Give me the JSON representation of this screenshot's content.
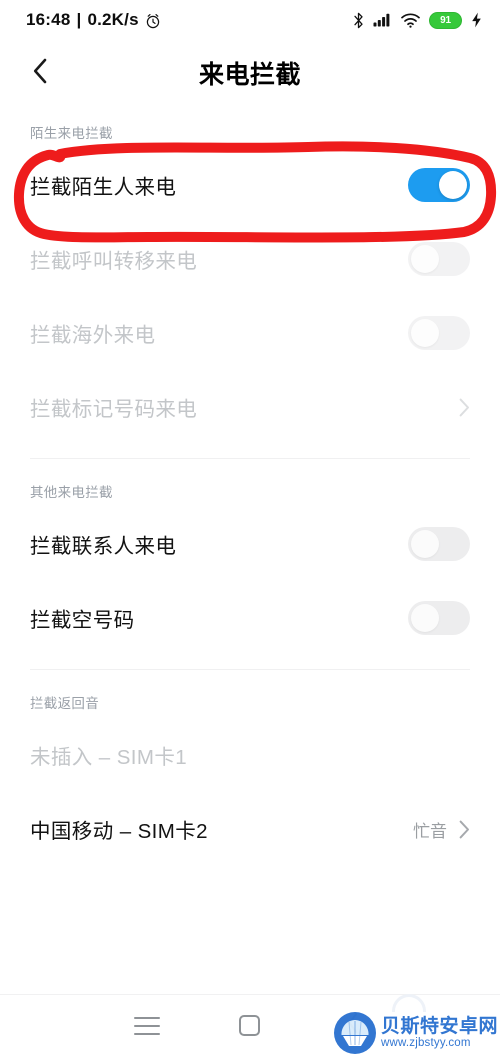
{
  "status_bar": {
    "time": "16:48",
    "separator": "|",
    "network_speed": "0.2K/s",
    "alarm_icon": "alarm-clock-icon",
    "bluetooth_icon": "bluetooth-icon",
    "signal_icon": "cellular-signal-icon",
    "wifi_icon": "wifi-icon",
    "battery_level": "91",
    "charging_icon": "charging-bolt-icon"
  },
  "header": {
    "back_icon": "back-chevron-icon",
    "title": "来电拦截"
  },
  "sections": [
    {
      "title": "陌生来电拦截",
      "title_disabled": false,
      "rows": [
        {
          "label": "拦截陌生人来电",
          "control": "toggle",
          "toggle_on": true,
          "disabled": false,
          "highlighted": true
        },
        {
          "label": "拦截呼叫转移来电",
          "control": "toggle",
          "toggle_on": false,
          "disabled": true,
          "highlighted": false
        },
        {
          "label": "拦截海外来电",
          "control": "toggle",
          "toggle_on": false,
          "disabled": true,
          "highlighted": false
        },
        {
          "label": "拦截标记号码来电",
          "control": "chevron",
          "value": "",
          "disabled": true,
          "highlighted": false
        }
      ]
    },
    {
      "title": "其他来电拦截",
      "title_disabled": false,
      "rows": [
        {
          "label": "拦截联系人来电",
          "control": "toggle",
          "toggle_on": false,
          "disabled": false,
          "highlighted": false
        },
        {
          "label": "拦截空号码",
          "control": "toggle",
          "toggle_on": false,
          "disabled": false,
          "highlighted": false
        }
      ]
    },
    {
      "title": "拦截返回音",
      "title_disabled": false,
      "rows": [
        {
          "label": "未插入 – SIM卡1",
          "control": "none",
          "value": "",
          "disabled": true,
          "highlighted": false
        },
        {
          "label": "中国移动 – SIM卡2",
          "control": "chevron",
          "value": "忙音",
          "disabled": false,
          "highlighted": false
        }
      ]
    }
  ],
  "annotation": {
    "shape": "red-rounded-rectangle",
    "color": "#ee1c1c",
    "targets": "拦截陌生人来电"
  },
  "nav_bar": {
    "menu_icon": "menu-icon",
    "home_icon": "home-square-icon",
    "back_icon": "back-chevron-icon"
  },
  "watermark": {
    "logo_icon": "shell-logo-icon",
    "site_name": "贝斯特安卓网",
    "site_url": "www.zjbstyy.com"
  },
  "colors": {
    "toggle_on": "#1d9cf0",
    "toggle_off": "#ededee",
    "battery": "#36c93a",
    "annotation": "#ee1c1c",
    "watermark": "#2a71d0"
  }
}
